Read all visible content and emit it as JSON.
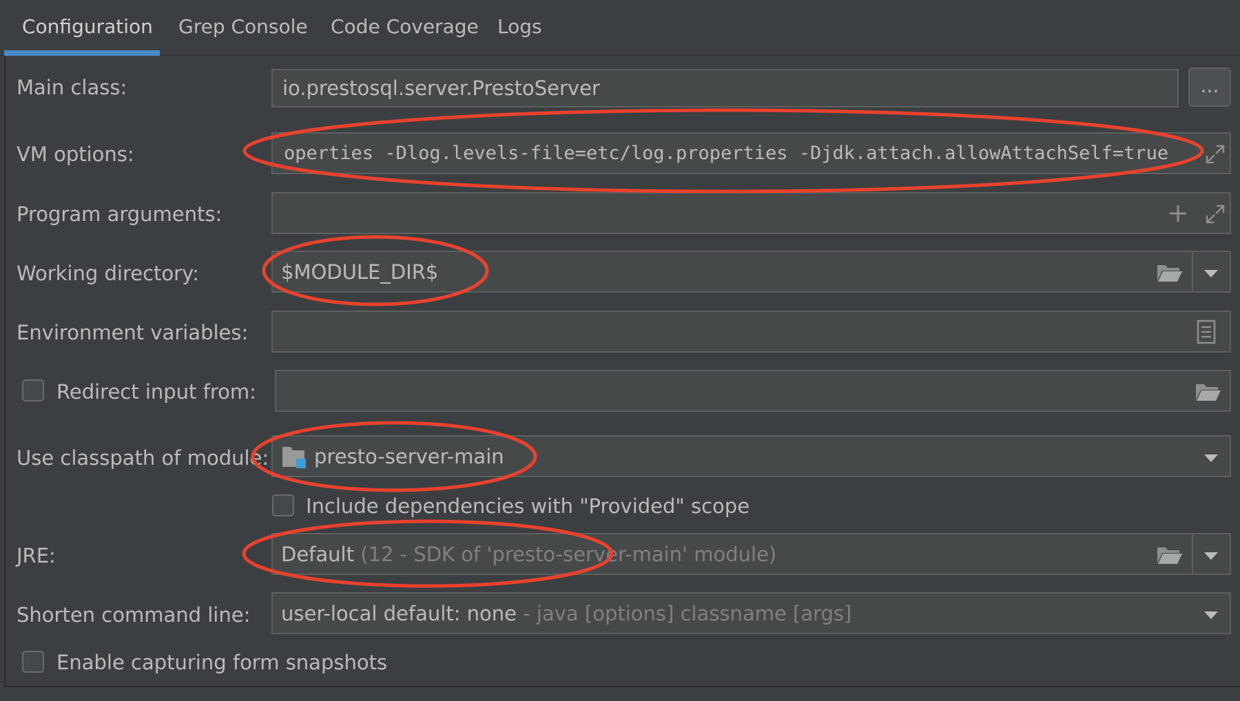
{
  "tabs": [
    {
      "label": "Configuration",
      "selected": true
    },
    {
      "label": "Grep Console"
    },
    {
      "label": "Code Coverage"
    },
    {
      "label": "Logs"
    }
  ],
  "form": {
    "main_class": {
      "label": "Main class:",
      "value": "io.prestosql.server.PrestoServer",
      "browse_label": "..."
    },
    "vm_options": {
      "label": "VM options:",
      "value": "operties -Dlog.levels-file=etc/log.properties -Djdk.attach.allowAttachSelf=true"
    },
    "program_arguments": {
      "label": "Program arguments:",
      "value": ""
    },
    "working_directory": {
      "label": "Working directory:",
      "value": "$MODULE_DIR$"
    },
    "environment_variables": {
      "label": "Environment variables:",
      "value": ""
    },
    "redirect_input": {
      "label": "Redirect input from:",
      "checked": false,
      "value": ""
    },
    "classpath_module": {
      "label": "Use classpath of module:",
      "value": "presto-server-main"
    },
    "include_provided": {
      "label": "Include dependencies with \"Provided\" scope",
      "checked": false
    },
    "jre": {
      "label": "JRE:",
      "value": "Default",
      "hint": "(12 - SDK of 'presto-server-main' module)"
    },
    "shorten_command_line": {
      "label": "Shorten command line:",
      "value": "user-local default: none",
      "hint": "- java [options] classname [args]"
    },
    "capture_snapshots": {
      "label": "Enable capturing form snapshots",
      "checked": false
    }
  },
  "colors": {
    "background": "#3c3f41",
    "field": "#45494a",
    "accent": "#4a88c7",
    "annotation": "#e8422e"
  },
  "icons": [
    "expand-icon",
    "plus-icon",
    "folder-icon",
    "document-icon",
    "module-folder-icon",
    "chevron-down-icon"
  ]
}
